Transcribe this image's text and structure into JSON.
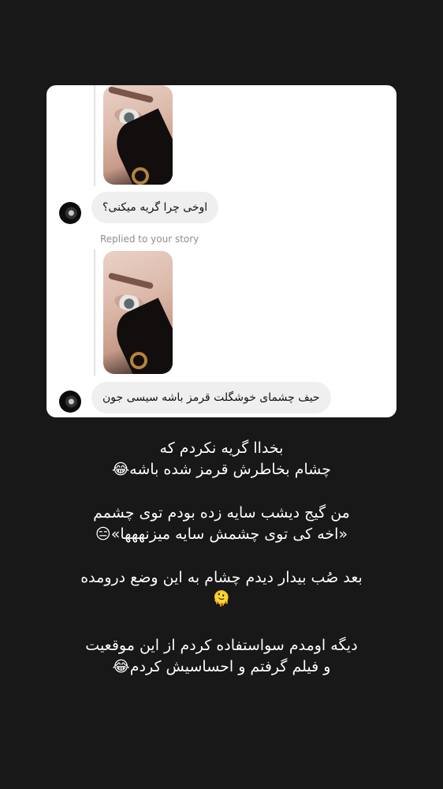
{
  "chat": {
    "message_1": "اوخی چرا گریه میکنی؟",
    "replied_label": "Replied to your story",
    "message_2": "حیف چشمای خوشگلت قرمز باشه سیسی جون"
  },
  "caption": {
    "line_1": "بخداا گریه نکردم که",
    "line_2": "چشام بخاطرش قرمز شده باشه😂",
    "line_3": "من گیج دیشب سایه زده بودم توی چشمم",
    "line_4": "«اخه کی توی چشمش سایه میزنههها»😑",
    "line_5": "بعد صُب بیدار دیدم چشام به این وضع درومده",
    "line_6": "🫠",
    "line_7": "دیگه اومدم سواستفاده کردم از این موقعیت",
    "line_8": "و فیلم گرفتم و احساسیش کردم😂"
  },
  "colors": {
    "background": "#181818",
    "card": "#ffffff",
    "bubble": "#efefef",
    "muted_text": "#8e8e8e"
  }
}
